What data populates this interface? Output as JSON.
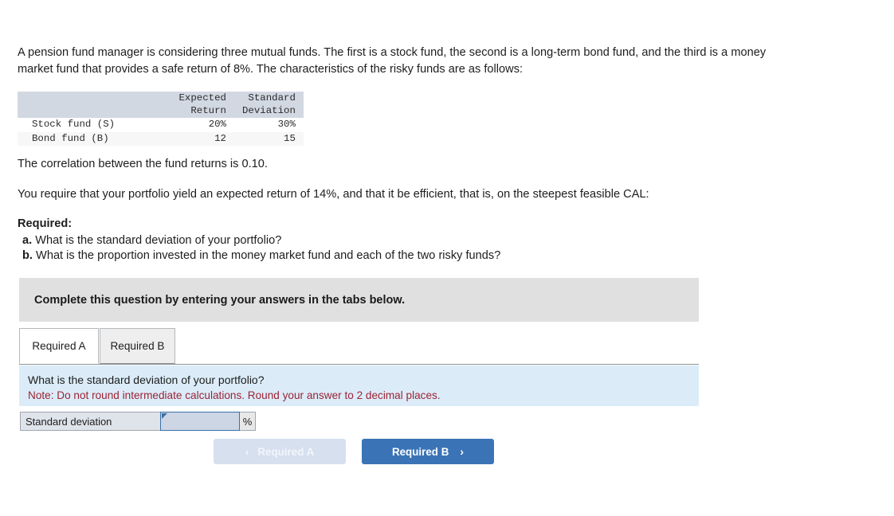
{
  "question": {
    "intro": "A pension fund manager is considering three mutual funds. The first is a stock fund, the second is a long-term bond fund, and the third is a money market fund that provides a safe return of 8%. The characteristics of the risky funds are as follows:",
    "correlation_statement": "The correlation between the fund returns is 0.10.",
    "requirement_statement": "You require that your portfolio yield an expected return of 14%, and that it be efficient, that is, on the steepest feasible CAL:"
  },
  "table": {
    "headers": [
      "",
      "Expected\nReturn",
      "Standard\nDeviation"
    ],
    "rows": [
      {
        "label": "Stock fund (S)",
        "expected_return": "20%",
        "standard_deviation": "30%"
      },
      {
        "label": "Bond fund (B)",
        "expected_return": "12",
        "standard_deviation": "15"
      }
    ]
  },
  "required": {
    "title": "Required:",
    "items": [
      {
        "marker": "a.",
        "text": "What is the standard deviation of your portfolio?"
      },
      {
        "marker": "b.",
        "text": "What is the proportion invested in the money market fund and each of the two risky funds?"
      }
    ]
  },
  "banner": {
    "text": "Complete this question by entering your answers in the tabs below."
  },
  "tabs": [
    {
      "label": "Required A",
      "active": true
    },
    {
      "label": "Required B",
      "active": false
    }
  ],
  "panel": {
    "question": "What is the standard deviation of your portfolio?",
    "note": "Note: Do not round intermediate calculations. Round your answer to 2 decimal places."
  },
  "answer": {
    "label": "Standard deviation",
    "value": "",
    "placeholder": "",
    "unit": "%"
  },
  "nav": {
    "prev_label": "Required A",
    "prev_chevron": "‹",
    "next_label": "Required B",
    "next_chevron": "›"
  },
  "colors": {
    "accent_blue": "#3b74b6",
    "disabled_blue": "#d6e0ef",
    "panel_blue": "#dbecf8",
    "banner_gray": "#e0e0e0",
    "table_header": "#d2d8e2",
    "note_red": "#9d2235"
  }
}
